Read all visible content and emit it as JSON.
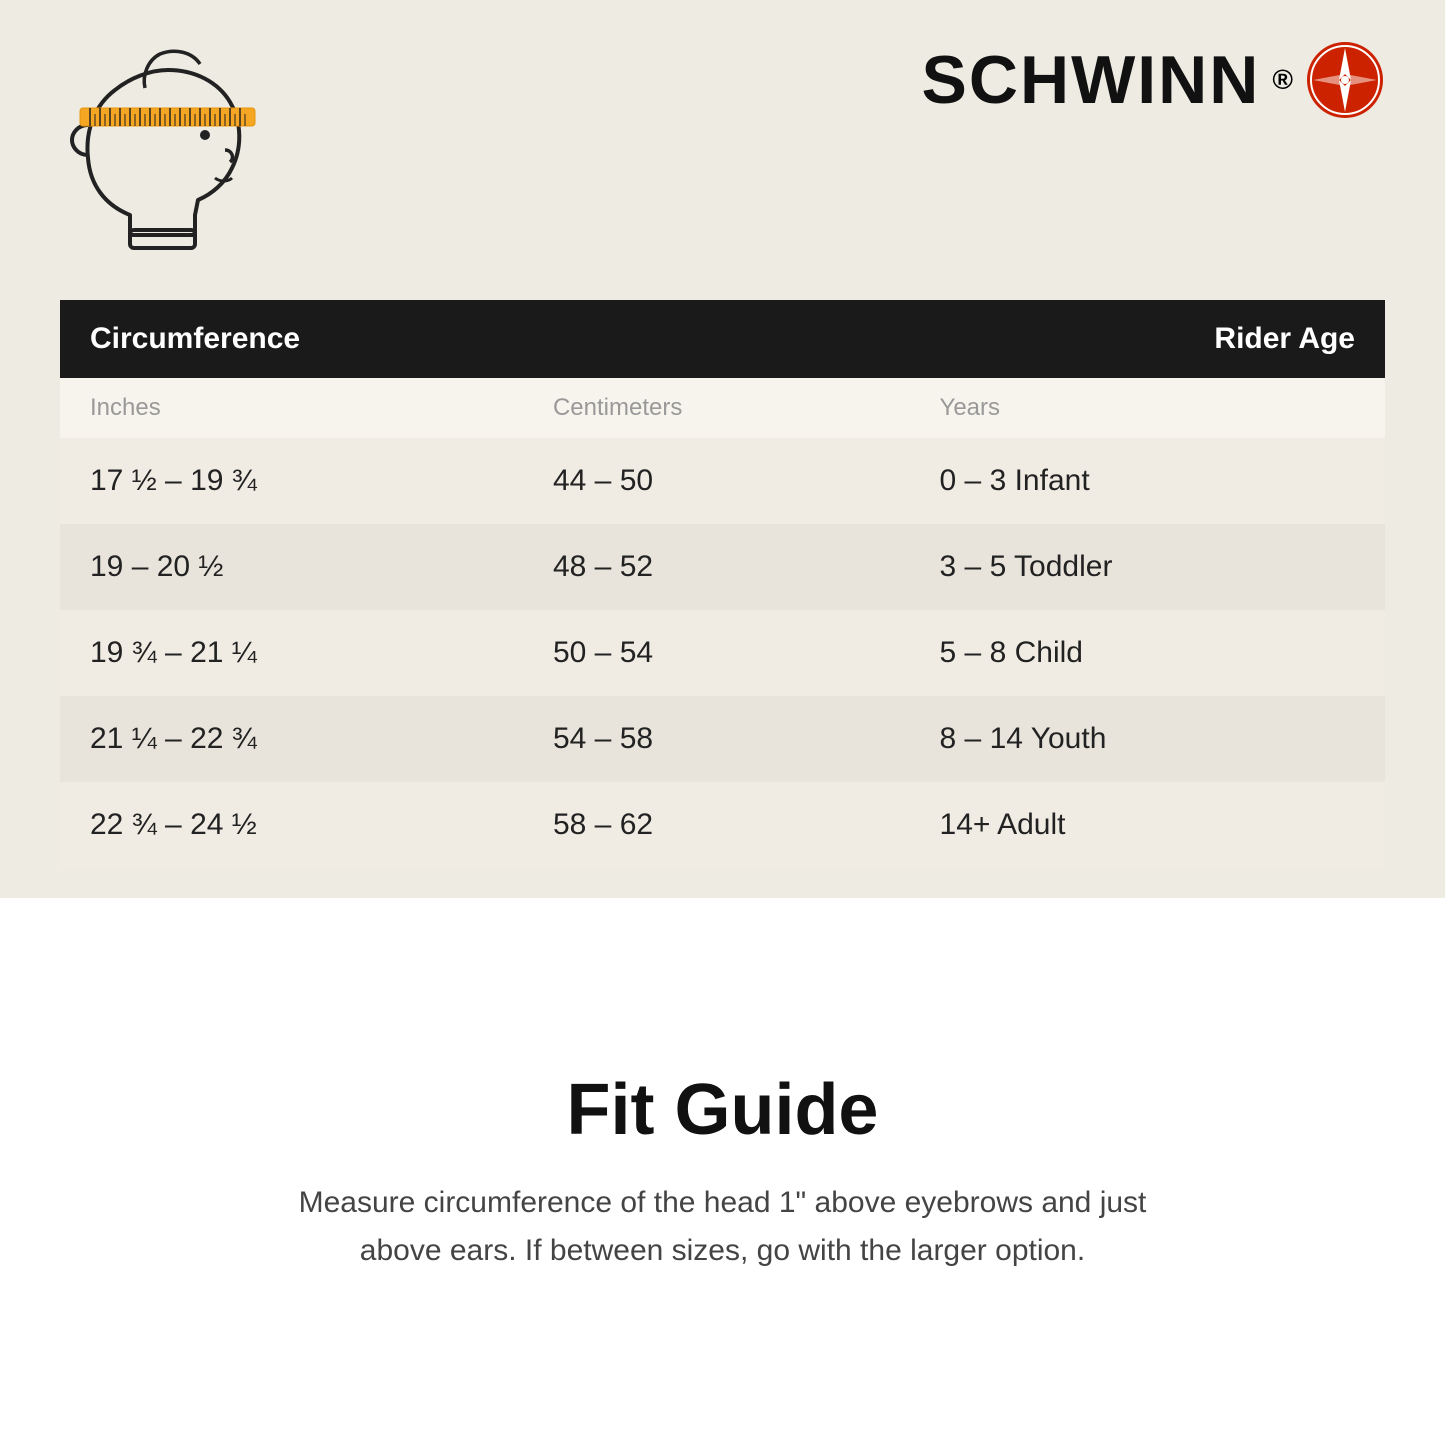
{
  "brand": {
    "name": "SCHWINN",
    "trademark": "®"
  },
  "table": {
    "header": {
      "col1": "Circumference",
      "col2": "",
      "col3": "Rider Age"
    },
    "subheader": {
      "col1": "Inches",
      "col2": "Centimeters",
      "col3": "Years"
    },
    "rows": [
      {
        "inches": "17 ½ – 19 ¾",
        "cm": "44 – 50",
        "age": "0 – 3 Infant"
      },
      {
        "inches": "19 – 20 ½",
        "cm": "48 – 52",
        "age": "3 – 5 Toddler"
      },
      {
        "inches": "19 ¾ – 21 ¼",
        "cm": "50 – 54",
        "age": "5 – 8 Child"
      },
      {
        "inches": "21 ¼ – 22 ¾",
        "cm": "54 – 58",
        "age": "8 – 14 Youth"
      },
      {
        "inches": "22 ¾ – 24 ½",
        "cm": "58 – 62",
        "age": "14+ Adult"
      }
    ]
  },
  "fitGuide": {
    "title": "Fit Guide",
    "description": "Measure circumference of the head 1\" above eyebrows and just above ears. If between sizes, go with the larger option."
  }
}
